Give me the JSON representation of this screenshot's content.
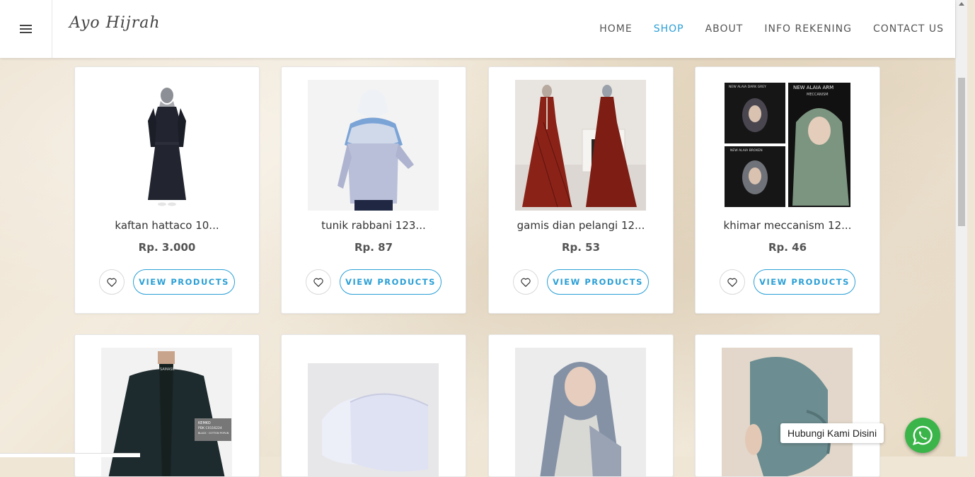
{
  "header": {
    "logo": "Ayo Hijrah",
    "nav": [
      {
        "label": "HOME",
        "active": false
      },
      {
        "label": "SHOP",
        "active": true
      },
      {
        "label": "ABOUT",
        "active": false
      },
      {
        "label": "INFO REKENING",
        "active": false
      },
      {
        "label": "CONTACT US",
        "active": false
      }
    ]
  },
  "products": [
    {
      "name": "kaftan hattaco 10...",
      "price": "Rp. 3.000",
      "button": "VIEW PRODUCTS"
    },
    {
      "name": "tunik rabbani 123...",
      "price": "Rp. 87",
      "button": "VIEW PRODUCTS"
    },
    {
      "name": "gamis dian pelangi 12...",
      "price": "Rp. 53",
      "button": "VIEW PRODUCTS"
    },
    {
      "name": "khimar meccanism 12...",
      "price": "Rp. 46",
      "button": "VIEW PRODUCTS"
    },
    {
      "name": "",
      "price": "",
      "button": ""
    },
    {
      "name": "",
      "price": "",
      "button": ""
    },
    {
      "name": "",
      "price": "",
      "button": ""
    },
    {
      "name": "",
      "price": "",
      "button": ""
    }
  ],
  "product_image_text": {
    "khimar_top_left": "NEW ALAIA DARK GREY",
    "khimar_top_right": "NEW ALAIA ARM",
    "khimar_sub": "MECCANISM",
    "khimar_bottom_left": "NEW ALAIA BROKEN",
    "koko_brand": "SAMASE",
    "koko_tag_1": "KEMKO",
    "koko_tag_2": "PDK C0116224",
    "koko_tag_3": "BLACK · COTTON POPLIN"
  },
  "whatsapp": {
    "label": "Hubungi Kami Disini"
  },
  "colors": {
    "accent": "#2a9fd6",
    "whatsapp": "#3bb54a"
  }
}
